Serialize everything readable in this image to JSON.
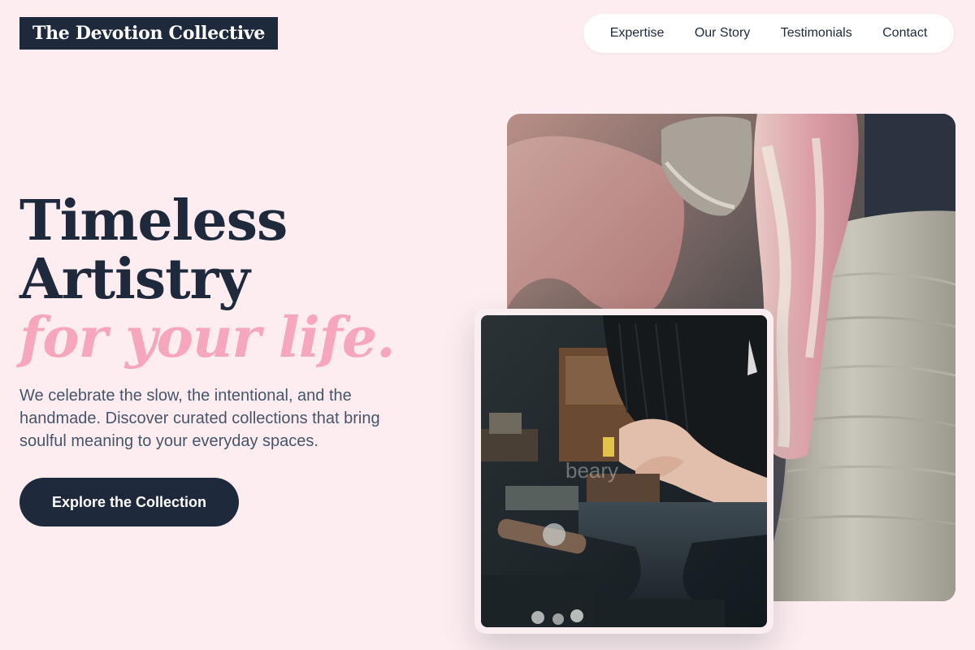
{
  "brand": {
    "name": "The Devotion Collective"
  },
  "nav": {
    "items": [
      {
        "label": "Expertise"
      },
      {
        "label": "Our Story"
      },
      {
        "label": "Testimonials"
      },
      {
        "label": "Contact"
      }
    ]
  },
  "hero": {
    "line1": "Timeless",
    "line2": "Artistry",
    "line3": "for your life.",
    "description": "We celebrate the slow, the intentional, and the handmade. Discover curated collections that bring soulful meaning to your everyday spaces.",
    "cta_label": "Explore the Collection"
  },
  "images": {
    "inset_watermark": "beary"
  },
  "colors": {
    "background": "#fdedf0",
    "primary": "#1e293b",
    "accent": "#f6a6bd",
    "body_text": "#475569"
  }
}
